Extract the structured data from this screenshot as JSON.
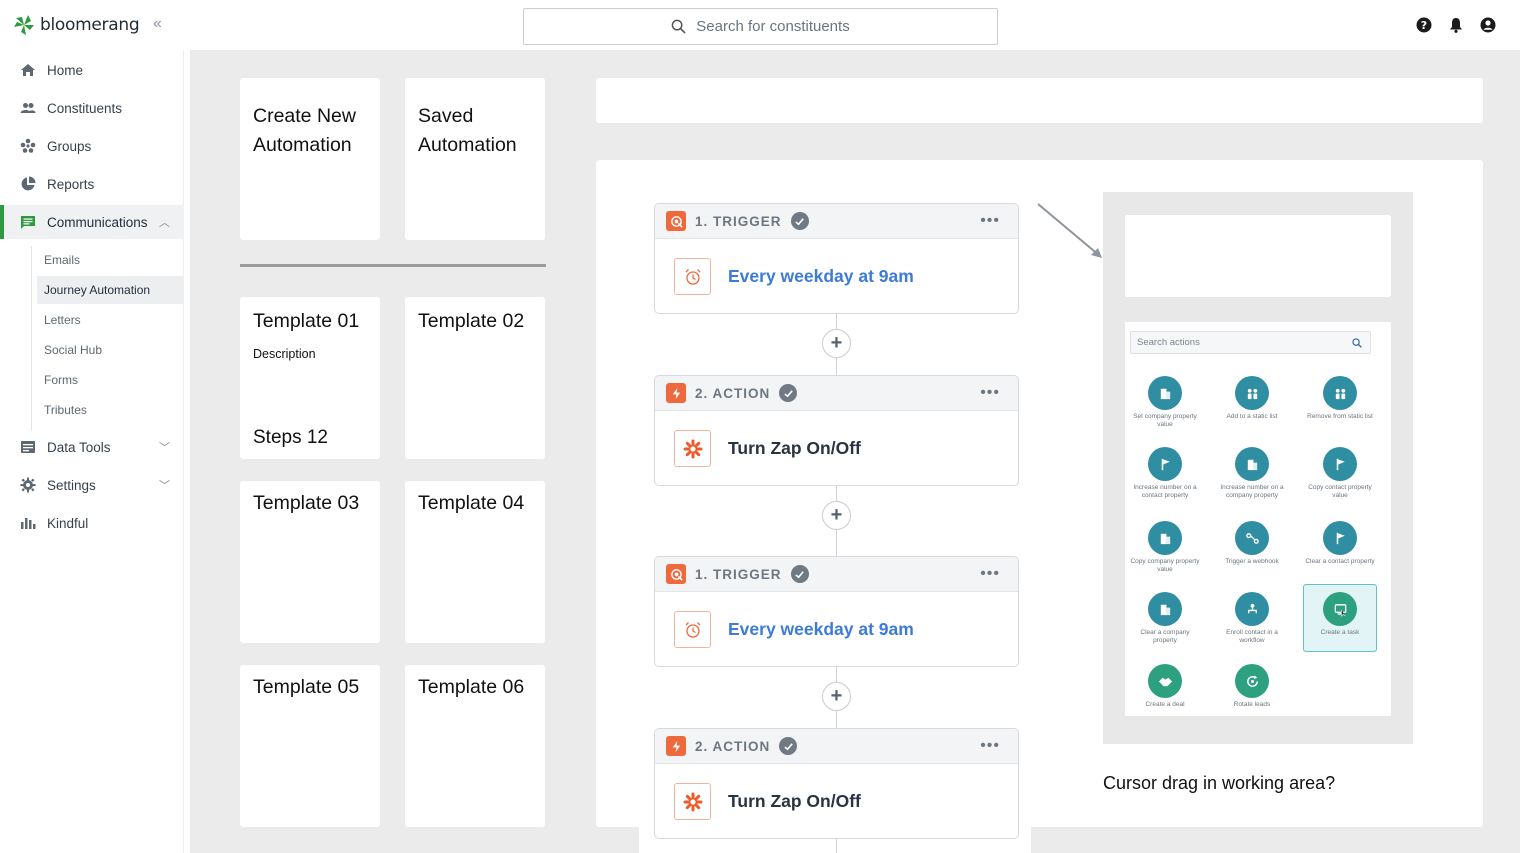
{
  "brand": {
    "name": "bloomerang",
    "accent": "#2e9a3f"
  },
  "header": {
    "search_placeholder": "Search for constituents",
    "icons": [
      "help-icon",
      "bell-icon",
      "user-icon"
    ]
  },
  "sidebar": {
    "items": [
      {
        "label": "Home",
        "icon": "home-icon"
      },
      {
        "label": "Constituents",
        "icon": "people-icon"
      },
      {
        "label": "Groups",
        "icon": "groups-icon"
      },
      {
        "label": "Reports",
        "icon": "pie-icon"
      },
      {
        "label": "Communications",
        "icon": "message-icon"
      },
      {
        "label": "Data Tools",
        "icon": "database-icon"
      },
      {
        "label": "Settings",
        "icon": "gear-icon"
      },
      {
        "label": "Kindful",
        "icon": "bars-icon"
      }
    ],
    "sub_items": [
      "Emails",
      "Journey Automation",
      "Letters",
      "Social Hub",
      "Forms",
      "Tributes"
    ]
  },
  "cards": {
    "create": "Create New Automation",
    "saved": "Saved Automation",
    "templates": [
      {
        "title": "Template 01",
        "description": "Description",
        "steps": "Steps 12"
      },
      {
        "title": "Template 02"
      },
      {
        "title": "Template 03"
      },
      {
        "title": "Template 04"
      },
      {
        "title": "Template 05"
      },
      {
        "title": "Template 06"
      }
    ]
  },
  "steps": [
    {
      "label": "1. TRIGGER",
      "text": "Every weekday at 9am",
      "kind": "trigger"
    },
    {
      "label": "2. ACTION",
      "text": "Turn Zap On/Off",
      "kind": "action"
    },
    {
      "label": "1. TRIGGER",
      "text": "Every weekday at 9am",
      "kind": "trigger"
    },
    {
      "label": "2. ACTION",
      "text": "Turn Zap On/Off",
      "kind": "action"
    }
  ],
  "picker": {
    "search_placeholder": "Search actions",
    "actions": [
      "Set company property value",
      "Add to a static list",
      "Remove from static list",
      "Increase number on a contact property",
      "Increase number on a company property",
      "Copy contact property value",
      "Copy company property value",
      "Trigger a webhook",
      "Clear a contact property",
      "Clear a company property",
      "Enroll contact in a workflow",
      "Create a task",
      "Create a deal",
      "Rotate leads"
    ],
    "selected": "Create a task"
  },
  "caption": "Cursor drag in working area?"
}
